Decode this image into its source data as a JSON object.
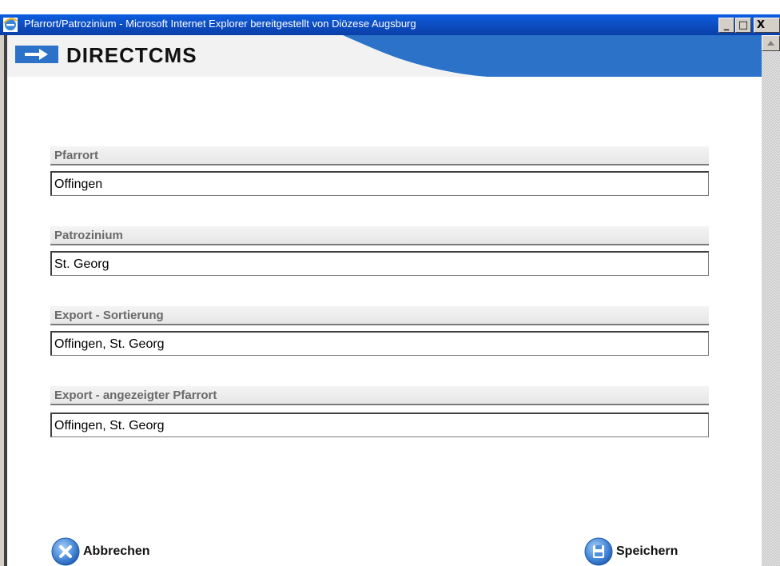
{
  "window": {
    "title": "Pfarrort/Patrozinium - Microsoft Internet Explorer bereitgestellt von Diözese Augsburg",
    "minimize_glyph": "_",
    "maximize_glyph": "□",
    "close_glyph": "X"
  },
  "header": {
    "logo_text": "DIRECTCMS",
    "logo_icon": "arrow-right-icon",
    "accent_color": "#2b72c8"
  },
  "form": {
    "fields": [
      {
        "label": "Pfarrort",
        "value": "Offingen"
      },
      {
        "label": "Patrozinium",
        "value": "St. Georg"
      },
      {
        "label": "Export - Sortierung",
        "value": "Offingen, St. Georg"
      },
      {
        "label": "Export - angezeigter Pfarrort",
        "value": "Offingen, St. Georg"
      }
    ]
  },
  "actions": {
    "cancel_label": "Abbrechen",
    "cancel_icon": "close-circle-icon",
    "save_label": "Speichern",
    "save_icon": "floppy-disk-icon"
  }
}
